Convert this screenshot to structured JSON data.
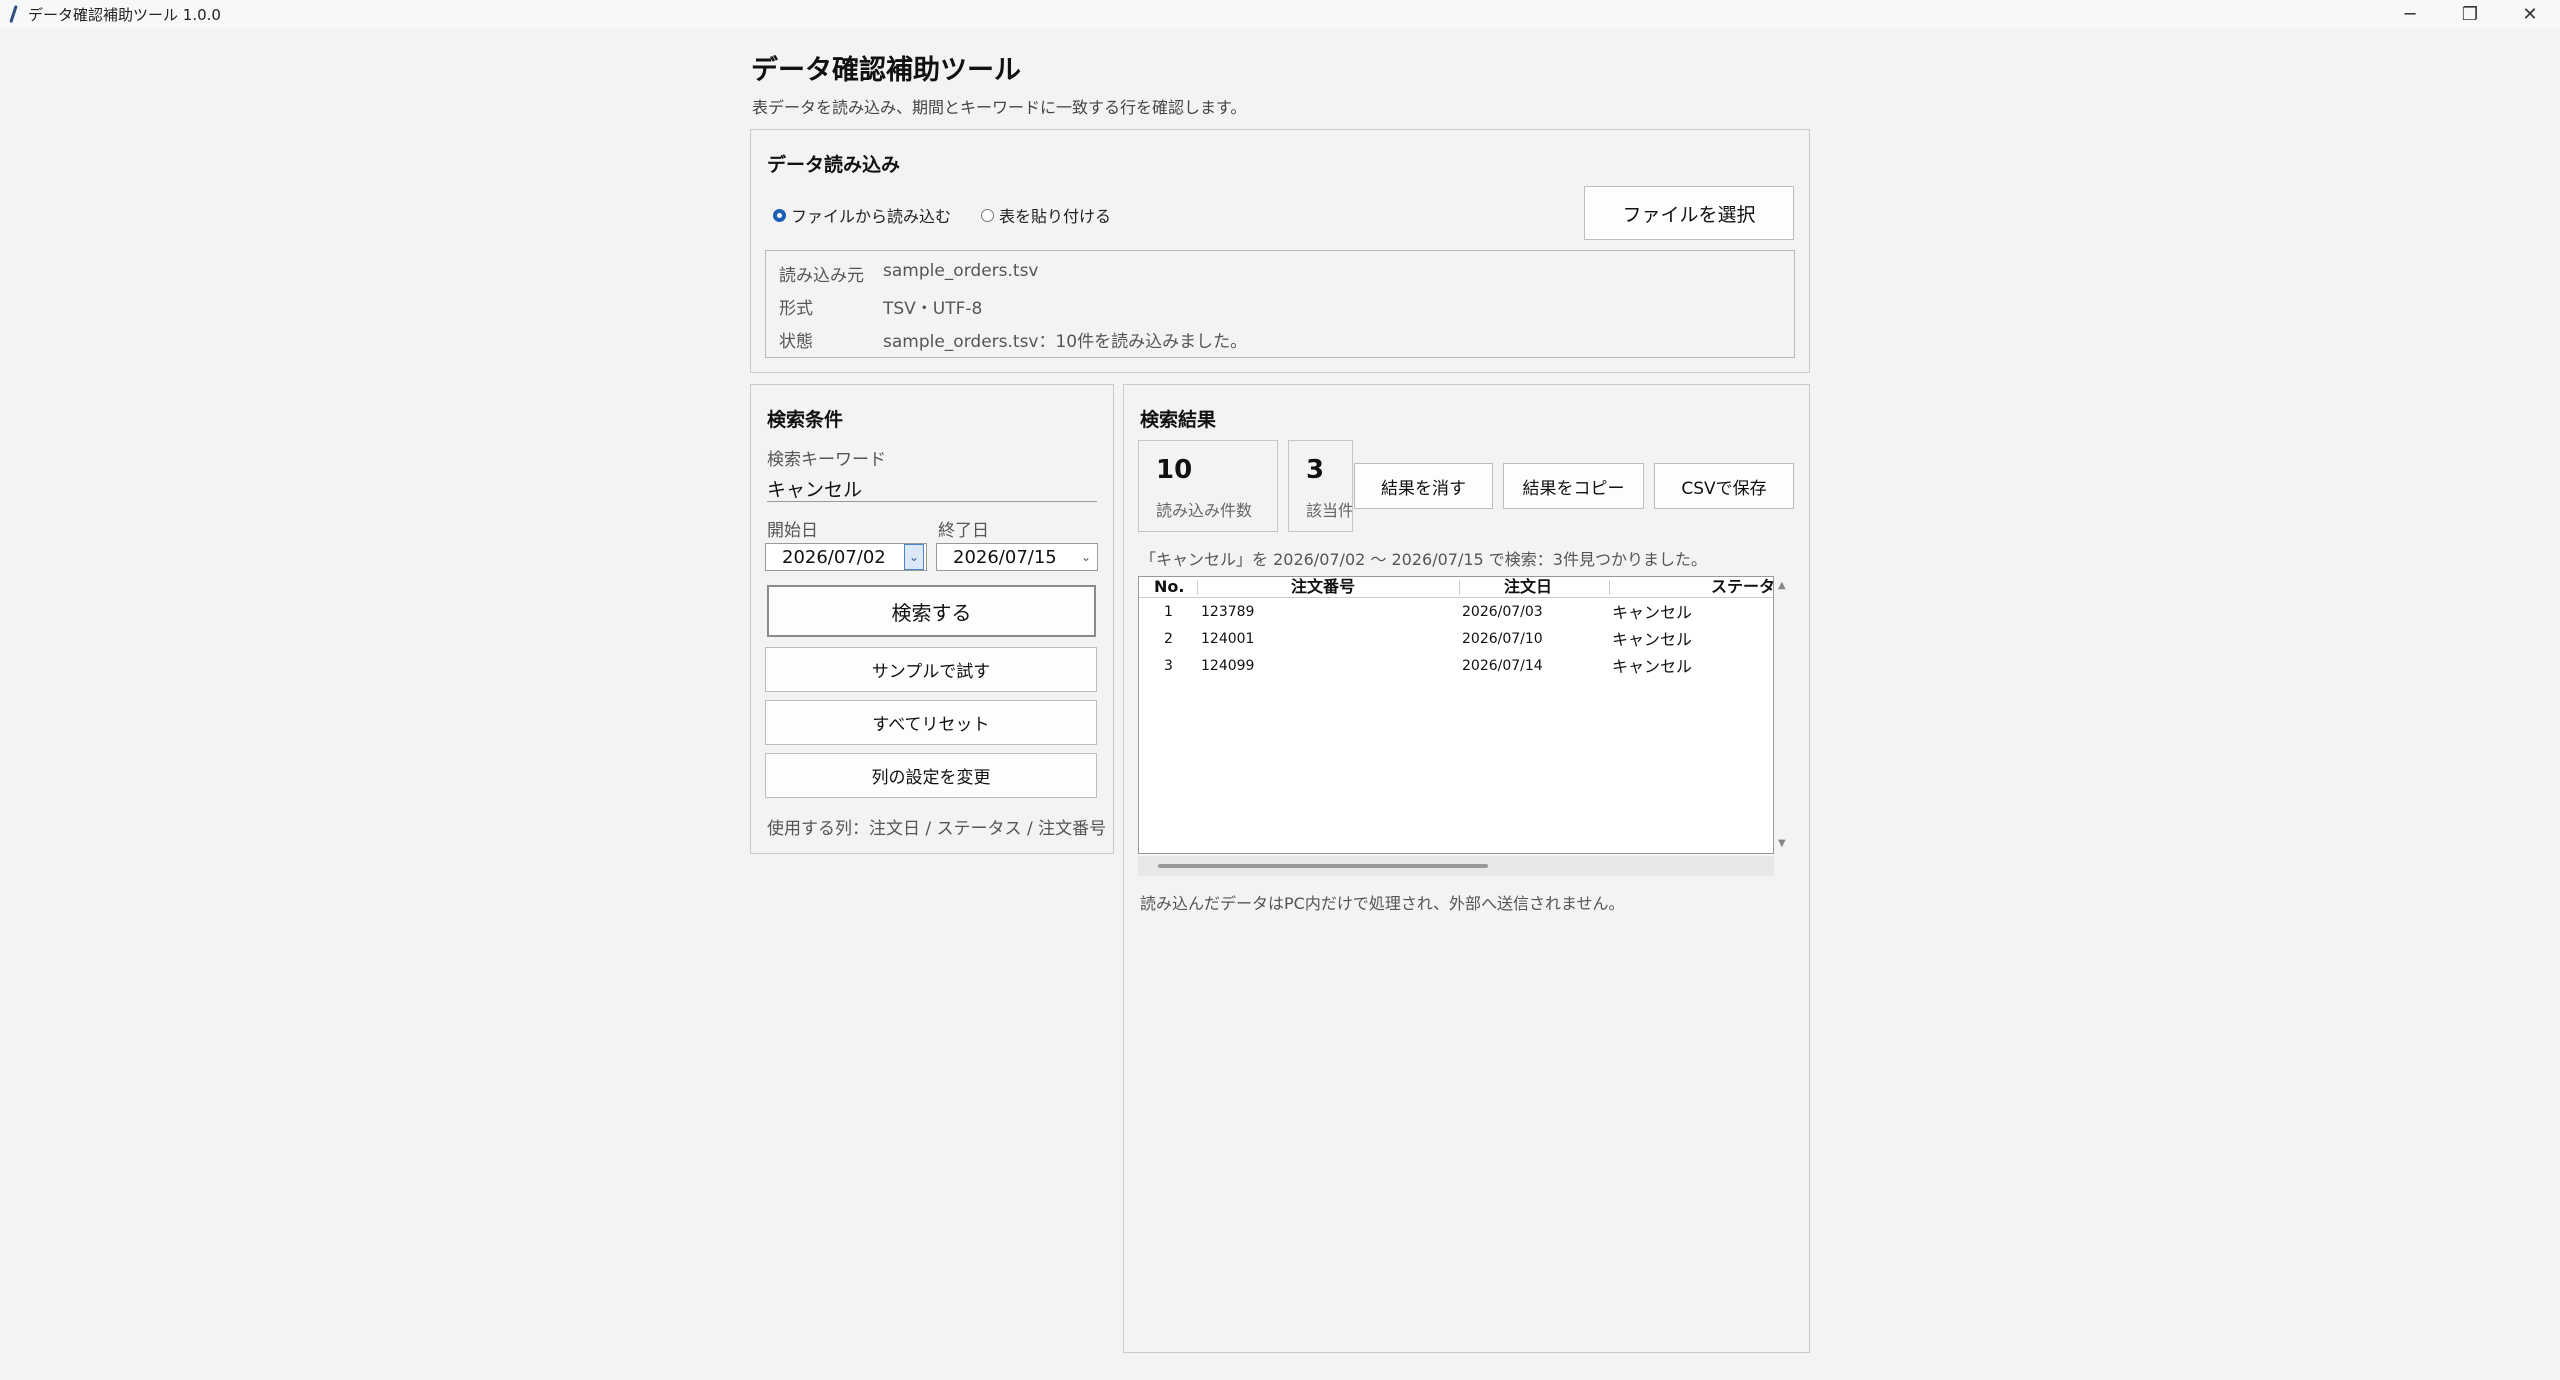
{
  "window": {
    "title": "データ確認補助ツール 1.0.0",
    "controls": {
      "minimize": "─",
      "restore": "❐",
      "close": "✕"
    }
  },
  "header": {
    "title": "データ確認補助ツール",
    "subtitle": "表データを読み込み、期間とキーワードに一致する行を確認します。"
  },
  "load_panel": {
    "title": "データ読み込み",
    "radio_file": "ファイルから読み込む",
    "radio_paste": "表を貼り付ける",
    "select_file_button": "ファイルを選択",
    "info": [
      {
        "key": "読み込み元",
        "value": "sample_orders.tsv"
      },
      {
        "key": "形式",
        "value": "TSV・UTF-8"
      },
      {
        "key": "状態",
        "value": "sample_orders.tsv：10件を読み込みました。"
      }
    ]
  },
  "search_panel": {
    "title": "検索条件",
    "keyword_label": "検索キーワード",
    "keyword_value": "キャンセル",
    "start_label": "開始日",
    "start_value": "2026/07/02",
    "end_label": "終了日",
    "end_value": "2026/07/15",
    "search_button": "検索する",
    "sample_button": "サンプルで試す",
    "reset_button": "すべてリセット",
    "columns_button": "列の設定を変更",
    "columns_text": "使用する列：注文日 / ステータス / 注文番号"
  },
  "results_panel": {
    "title": "検索結果",
    "loaded_count": "10",
    "loaded_label": "読み込み件数",
    "match_count": "3",
    "match_label": "該当件数",
    "clear_button": "結果を消す",
    "copy_button": "結果をコピー",
    "csv_button": "CSVで保存",
    "message": "「キャンセル」を 2026/07/02 〜 2026/07/15 で検索：3件見つかりました。",
    "columns": [
      "No.",
      "注文番号",
      "注文日",
      "ステータス"
    ],
    "rows": [
      {
        "no": "1",
        "order": "123789",
        "date": "2026/07/03",
        "status": "キャンセル"
      },
      {
        "no": "2",
        "order": "124001",
        "date": "2026/07/10",
        "status": "キャンセル"
      },
      {
        "no": "3",
        "order": "124099",
        "date": "2026/07/14",
        "status": "キャンセル"
      }
    ],
    "footnote": "読み込んだデータはPC内だけで処理され、外部へ送信されません。"
  }
}
